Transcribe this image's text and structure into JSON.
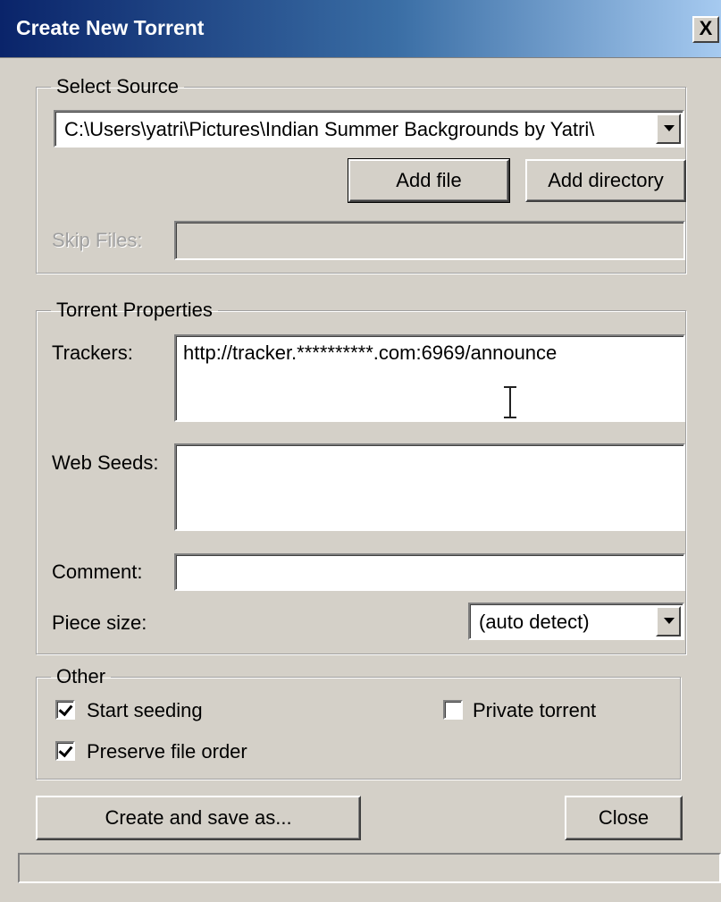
{
  "window": {
    "title": "Create New Torrent",
    "close_glyph": "X"
  },
  "select_source": {
    "legend": "Select Source",
    "path_value": "C:\\Users\\yatri\\Pictures\\Indian Summer Backgrounds by Yatri\\",
    "add_file_label": "Add file",
    "add_directory_label": "Add directory",
    "skip_files_label": "Skip Files:",
    "skip_files_value": ""
  },
  "torrent_properties": {
    "legend": "Torrent Properties",
    "trackers_label": "Trackers:",
    "trackers_value": "http://tracker.**********.com:6969/announce",
    "web_seeds_label": "Web Seeds:",
    "web_seeds_value": "",
    "comment_label": "Comment:",
    "comment_value": "",
    "piece_size_label": "Piece size:",
    "piece_size_value": "(auto detect)"
  },
  "other": {
    "legend": "Other",
    "start_seeding_label": "Start seeding",
    "start_seeding_checked": true,
    "private_torrent_label": "Private torrent",
    "private_torrent_checked": false,
    "preserve_order_label": "Preserve file order",
    "preserve_order_checked": true
  },
  "actions": {
    "create_label": "Create and save as...",
    "close_label": "Close"
  },
  "colors": {
    "face": "#d4d0c8",
    "title_start": "#0a246a",
    "title_end": "#a6caf0"
  },
  "icons": {
    "cursor": "text-cursor-icon",
    "dropdown": "chevron-down-icon",
    "check": "checkmark-icon"
  }
}
